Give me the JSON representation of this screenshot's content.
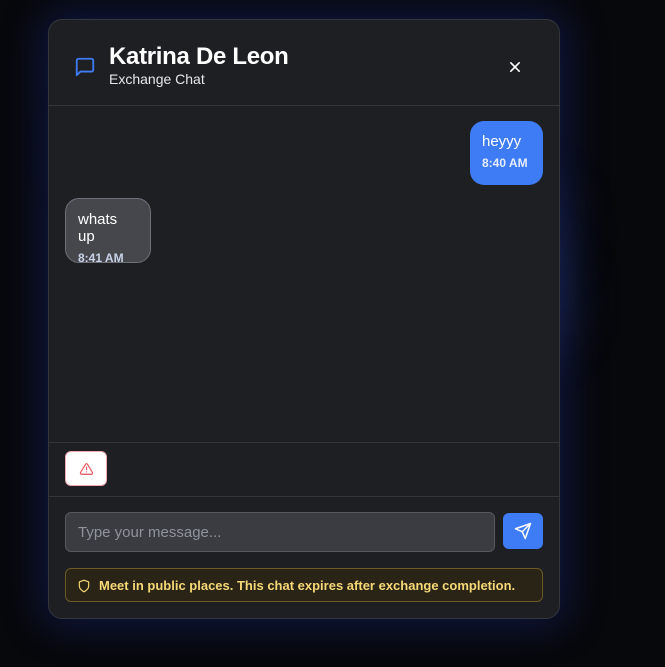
{
  "chat": {
    "contact_name": "Katrina De Leon",
    "subtitle": "Exchange Chat"
  },
  "messages": [
    {
      "direction": "outgoing",
      "text": "heyyy",
      "time": "8:40 AM"
    },
    {
      "direction": "incoming",
      "text": "whats up",
      "time": "8:41 AM"
    }
  ],
  "composer": {
    "placeholder": "Type your message...",
    "value": ""
  },
  "notice": {
    "text": "Meet in public places. This chat expires after exchange completion."
  },
  "icons": {
    "header": "chat-bubble-icon",
    "close": "close-icon",
    "report": "warning-triangle-icon",
    "send": "send-icon",
    "notice": "shield-icon"
  },
  "colors": {
    "accent": "#3d7cf4",
    "modal_bg": "#1e1f23",
    "report_red": "#e8505b",
    "notice_text": "#f5d877"
  }
}
